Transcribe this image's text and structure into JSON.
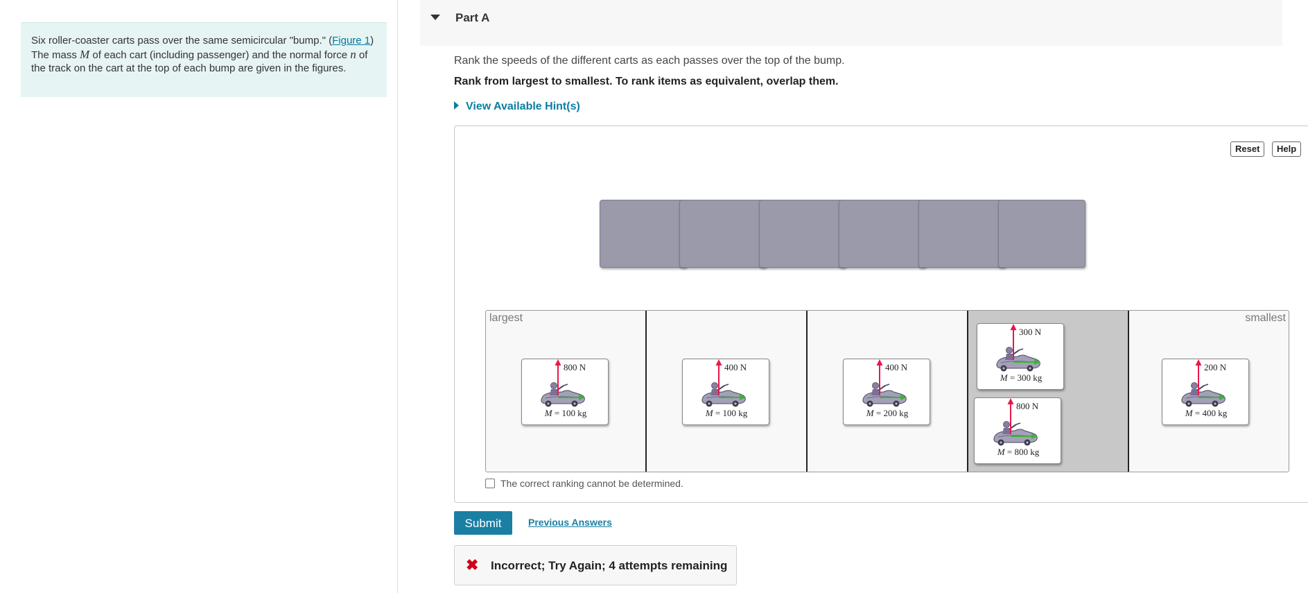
{
  "intro": {
    "text_before": "Six roller-coaster carts pass over the same semicircular \"bump.\" (",
    "figure_link": "Figure 1",
    "text_mid1": ") The mass ",
    "var_m": "M",
    "text_mid2": " of each cart (including passenger) and the normal force ",
    "var_n": "n",
    "text_after": " of the track on the cart at the top of each bump are given in the figures."
  },
  "part": {
    "title": "Part A"
  },
  "question": {
    "prompt": "Rank the speeds of the different carts as each passes over the top of the bump.",
    "instruction": "Rank from largest to smallest. To rank items as equivalent, overlap them."
  },
  "hint": {
    "label": "View Available Hint(s)"
  },
  "toolbar": {
    "reset_label": "Reset",
    "help_label": "Help"
  },
  "ranking": {
    "largest_label": "largest",
    "smallest_label": "smallest",
    "placed_cards": [
      {
        "force": "800 N",
        "mass": "100 kg"
      },
      {
        "force": "400 N",
        "mass": "100 kg"
      },
      {
        "force": "400 N",
        "mass": "200 kg"
      },
      {
        "force": "300 N",
        "mass": "300 kg"
      },
      {
        "force": "800 N",
        "mass": "800 kg"
      },
      {
        "force": "200 N",
        "mass": "400 kg"
      }
    ],
    "cannot_determine_label": "The correct ranking cannot be determined."
  },
  "actions": {
    "submit_label": "Submit",
    "previous_answers_label": "Previous Answers"
  },
  "feedback": {
    "message": "Incorrect; Try Again; 4 attempts remaining"
  },
  "colors": {
    "accent": "#1a7fa3",
    "error": "#d0021b",
    "slot": "#9b9aab",
    "force_arrow": "#e8174a",
    "velocity_arrow": "#3fb03a"
  }
}
